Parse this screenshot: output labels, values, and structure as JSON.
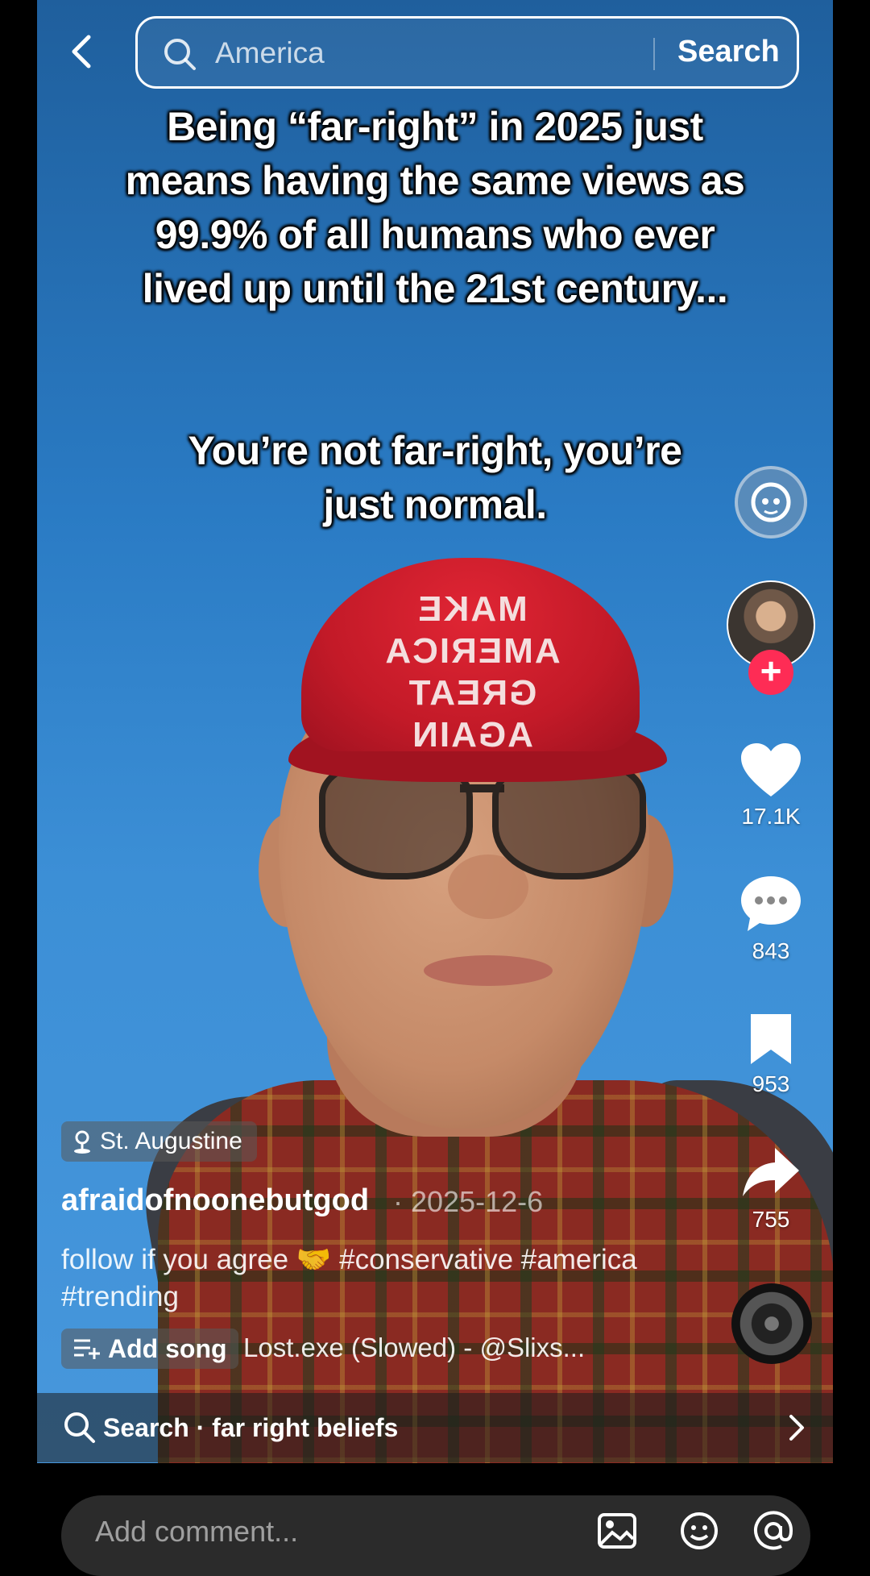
{
  "search": {
    "query": "America",
    "button": "Search"
  },
  "overlay": {
    "line1": "Being “far-right” in 2025 just means having the same views as 99.9% of all humans who ever lived up until the 21st century...",
    "line2": "You’re not far-right, you’re just normal."
  },
  "hat_text": "MAKE AMERICA GREAT AGAIN",
  "rail": {
    "likes": "17.1K",
    "comments": "843",
    "saves": "953",
    "shares": "755"
  },
  "post": {
    "location": "St. Augustine",
    "username": "afraidofnoonebutgod",
    "date": "· 2025-12-6",
    "caption": "follow if you agree 🤝 #conservative #america #trending",
    "add_song": "Add song",
    "song": "Lost.exe (Slowed) - @Slixs..."
  },
  "related_search": "Search · far right beliefs",
  "comment_placeholder": "Add comment...",
  "colors": {
    "accent": "#fe2c55",
    "sky": "#2f80c8",
    "cap": "#c8202e"
  }
}
